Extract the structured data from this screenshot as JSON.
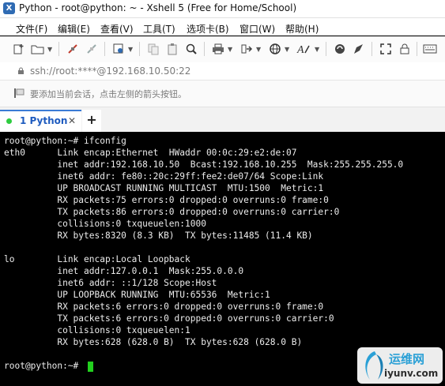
{
  "window": {
    "title": "Python - root@python: ~ - Xshell 5 (Free for Home/School)"
  },
  "menu": [
    {
      "label": "文件(F)"
    },
    {
      "label": "编辑(E)"
    },
    {
      "label": "查看(V)"
    },
    {
      "label": "工具(T)"
    },
    {
      "label": "选项卡(B)"
    },
    {
      "label": "窗口(W)"
    },
    {
      "label": "帮助(H)"
    }
  ],
  "toolbar": {
    "icons": [
      "new-session-icon",
      "open-folder-icon",
      "disconnect-icon",
      "reconnect-icon",
      "properties-icon",
      "copy-icon",
      "paste-icon",
      "find-icon",
      "print-icon",
      "transfer-icon",
      "globe-icon",
      "font-icon",
      "script-icon",
      "compose-icon",
      "fullscreen-icon",
      "lock-icon",
      "keyboard-icon"
    ]
  },
  "address": {
    "text": "ssh://root:****@192.168.10.50:22"
  },
  "hint": {
    "text": "要添加当前会话，点击左侧的箭头按钮。"
  },
  "tabs": [
    {
      "label": "1 Python",
      "active": true,
      "status_color": "#2ecc40"
    }
  ],
  "terminal": {
    "lines": [
      "root@python:~# ifconfig",
      "eth0      Link encap:Ethernet  HWaddr 00:0c:29:e2:de:07",
      "          inet addr:192.168.10.50  Bcast:192.168.10.255  Mask:255.255.255.0",
      "          inet6 addr: fe80::20c:29ff:fee2:de07/64 Scope:Link",
      "          UP BROADCAST RUNNING MULTICAST  MTU:1500  Metric:1",
      "          RX packets:75 errors:0 dropped:0 overruns:0 frame:0",
      "          TX packets:86 errors:0 dropped:0 overruns:0 carrier:0",
      "          collisions:0 txqueuelen:1000",
      "          RX bytes:8320 (8.3 KB)  TX bytes:11485 (11.4 KB)",
      "",
      "lo        Link encap:Local Loopback",
      "          inet addr:127.0.0.1  Mask:255.0.0.0",
      "          inet6 addr: ::1/128 Scope:Host",
      "          UP LOOPBACK RUNNING  MTU:65536  Metric:1",
      "          RX packets:6 errors:0 dropped:0 overruns:0 frame:0",
      "          TX packets:6 errors:0 dropped:0 overruns:0 carrier:0",
      "          collisions:0 txqueuelen:1",
      "          RX bytes:628 (628.0 B)  TX bytes:628 (628.0 B)",
      "",
      "root@python:~# "
    ],
    "text_color": "#ececec",
    "cursor_color": "#22d01e"
  },
  "watermark": {
    "text": "运维网",
    "url": "iyunv.com"
  }
}
